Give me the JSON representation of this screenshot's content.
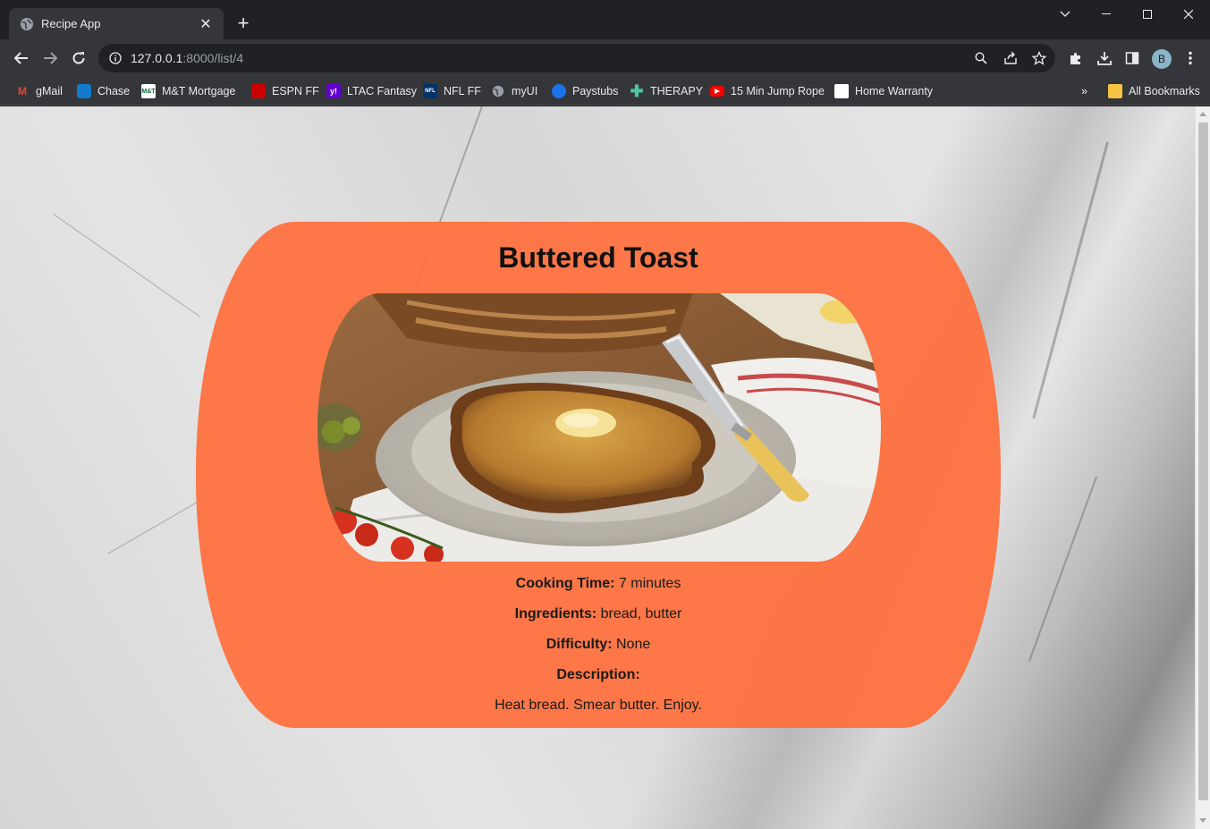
{
  "browser": {
    "tab_title": "Recipe App",
    "url_host": "127.0.0.1",
    "url_path": ":8000/list/4",
    "avatar_initial": "B",
    "bookmarks": [
      {
        "label": "gMail",
        "icon": "gmail-icon",
        "color": "#ea4335"
      },
      {
        "label": "Chase",
        "icon": "chase-icon",
        "color": "#117aca"
      },
      {
        "label": "M&T Mortgage",
        "icon": "mt-icon",
        "color": "#ffffff"
      },
      {
        "label": "ESPN FF",
        "icon": "espn-icon",
        "color": "#cc0000"
      },
      {
        "label": "LTAC Fantasy",
        "icon": "yahoo-icon",
        "color": "#6001d2"
      },
      {
        "label": "NFL FF",
        "icon": "nfl-icon",
        "color": "#013369"
      },
      {
        "label": "myUI",
        "icon": "globe-icon",
        "color": "#9aa0a6"
      },
      {
        "label": "Paystubs",
        "icon": "paystubs-icon",
        "color": "#1a73e8"
      },
      {
        "label": "THERAPY",
        "icon": "plus-icon",
        "color": "#4fc3a1"
      },
      {
        "label": "15 Min Jump Rope",
        "icon": "youtube-icon",
        "color": "#ff0000"
      },
      {
        "label": "Home Warranty",
        "icon": "home-warranty-icon",
        "color": "#ffffff"
      }
    ],
    "more_bookmarks": "»",
    "all_bookmarks": "All Bookmarks"
  },
  "recipe": {
    "title": "Buttered Toast",
    "cooking_time_label": "Cooking Time:",
    "cooking_time_value": "7 minutes",
    "ingredients_label": "Ingredients:",
    "ingredients_value": "bread, butter",
    "difficulty_label": "Difficulty:",
    "difficulty_value": "None",
    "description_label": "Description:",
    "description_value": "Heat bread. Smear butter. Enjoy."
  },
  "colors": {
    "card": "#ff6f3c",
    "chrome_dark": "#202124",
    "chrome_mid": "#35363a"
  }
}
